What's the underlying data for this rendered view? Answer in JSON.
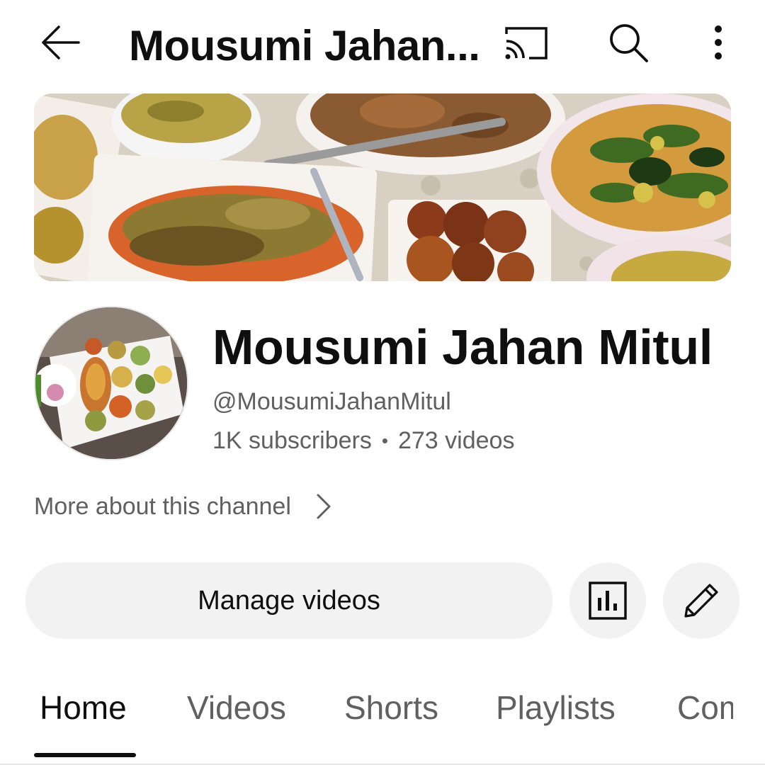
{
  "header": {
    "title": "Mousumi Jahan...",
    "back_icon": "arrow-left-icon",
    "cast_icon": "cast-icon",
    "search_icon": "search-icon",
    "more_icon": "more-vertical-icon"
  },
  "banner": {
    "image": "food-dishes-banner"
  },
  "channel": {
    "name": "Mousumi Jahan Mitul",
    "handle": "@MousumiJahanMitul",
    "subscribers": "1K subscribers",
    "separator": "•",
    "videos": "273 videos",
    "more_about": "More about this channel",
    "avatar_image": "food-platter-avatar"
  },
  "actions": {
    "manage_videos": "Manage videos",
    "analytics_icon": "analytics-icon",
    "edit_icon": "pencil-icon"
  },
  "tabs": [
    {
      "label": "Home",
      "active": true
    },
    {
      "label": "Videos",
      "active": false
    },
    {
      "label": "Shorts",
      "active": false
    },
    {
      "label": "Playlists",
      "active": false
    },
    {
      "label": "Community",
      "active": false
    }
  ],
  "colors": {
    "text_primary": "#0f0f0f",
    "text_secondary": "#606060",
    "button_bg": "#f2f2f2",
    "background": "#ffffff"
  }
}
